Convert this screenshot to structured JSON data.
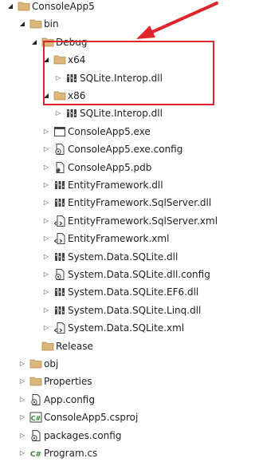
{
  "tree": [
    {
      "label": "ConsoleApp5",
      "icon": "folder-icon",
      "state": "expanded",
      "depth": 0,
      "name": "tree-item-consoleapp5"
    },
    {
      "label": "bin",
      "icon": "folder-icon",
      "state": "expanded",
      "depth": 1,
      "name": "tree-item-bin"
    },
    {
      "label": "Debug",
      "icon": "folder-icon",
      "state": "expanded",
      "depth": 2,
      "name": "tree-item-debug"
    },
    {
      "label": "x64",
      "icon": "folder-icon",
      "state": "expanded",
      "depth": 3,
      "name": "tree-item-x64"
    },
    {
      "label": "SQLite.Interop.dll",
      "icon": "dll-icon",
      "state": "collapsed",
      "depth": 4,
      "name": "tree-item-x64-sqlite-interop-dll"
    },
    {
      "label": "x86",
      "icon": "folder-icon",
      "state": "expanded",
      "depth": 3,
      "name": "tree-item-x86"
    },
    {
      "label": "SQLite.Interop.dll",
      "icon": "dll-icon",
      "state": "collapsed",
      "depth": 4,
      "name": "tree-item-x86-sqlite-interop-dll"
    },
    {
      "label": "ConsoleApp5.exe",
      "icon": "exe-icon",
      "state": "collapsed",
      "depth": 3,
      "name": "tree-item-consoleapp5-exe"
    },
    {
      "label": "ConsoleApp5.exe.config",
      "icon": "config-file-icon",
      "state": "collapsed",
      "depth": 3,
      "name": "tree-item-consoleapp5-exe-config"
    },
    {
      "label": "ConsoleApp5.pdb",
      "icon": "pdb-icon",
      "state": "collapsed",
      "depth": 3,
      "name": "tree-item-consoleapp5-pdb"
    },
    {
      "label": "EntityFramework.dll",
      "icon": "dll-icon",
      "state": "collapsed",
      "depth": 3,
      "name": "tree-item-entityframework-dll"
    },
    {
      "label": "EntityFramework.SqlServer.dll",
      "icon": "dll-icon",
      "state": "collapsed",
      "depth": 3,
      "name": "tree-item-entityframework-sqlserver-dll"
    },
    {
      "label": "EntityFramework.SqlServer.xml",
      "icon": "xml-file-icon",
      "state": "collapsed",
      "depth": 3,
      "name": "tree-item-entityframework-sqlserver-xml"
    },
    {
      "label": "EntityFramework.xml",
      "icon": "xml-file-icon",
      "state": "collapsed",
      "depth": 3,
      "name": "tree-item-entityframework-xml"
    },
    {
      "label": "System.Data.SQLite.dll",
      "icon": "dll-icon",
      "state": "collapsed",
      "depth": 3,
      "name": "tree-item-system-data-sqlite-dll"
    },
    {
      "label": "System.Data.SQLite.dll.config",
      "icon": "config-file-icon",
      "state": "collapsed",
      "depth": 3,
      "name": "tree-item-system-data-sqlite-dll-config"
    },
    {
      "label": "System.Data.SQLite.EF6.dll",
      "icon": "dll-icon",
      "state": "collapsed",
      "depth": 3,
      "name": "tree-item-system-data-sqlite-ef6-dll"
    },
    {
      "label": "System.Data.SQLite.Linq.dll",
      "icon": "dll-icon",
      "state": "collapsed",
      "depth": 3,
      "name": "tree-item-system-data-sqlite-linq-dll"
    },
    {
      "label": "System.Data.SQLite.xml",
      "icon": "xml-file-icon",
      "state": "collapsed",
      "depth": 3,
      "name": "tree-item-system-data-sqlite-xml"
    },
    {
      "label": "Release",
      "icon": "folder-icon",
      "state": "none",
      "depth": 2,
      "name": "tree-item-release"
    },
    {
      "label": "obj",
      "icon": "folder-icon",
      "state": "collapsed",
      "depth": 1,
      "name": "tree-item-obj"
    },
    {
      "label": "Properties",
      "icon": "folder-icon",
      "state": "collapsed",
      "depth": 1,
      "name": "tree-item-properties"
    },
    {
      "label": "App.config",
      "icon": "config-file-icon",
      "state": "collapsed",
      "depth": 1,
      "name": "tree-item-app-config"
    },
    {
      "label": "ConsoleApp5.csproj",
      "icon": "csharp-project-icon",
      "state": "collapsed",
      "depth": 1,
      "name": "tree-item-consoleapp5-csproj"
    },
    {
      "label": "packages.config",
      "icon": "config-file-icon",
      "state": "collapsed",
      "depth": 1,
      "name": "tree-item-packages-config"
    },
    {
      "label": "Program.cs",
      "icon": "csharp-file-icon",
      "state": "collapsed",
      "depth": 1,
      "name": "tree-item-program-cs"
    }
  ],
  "colors": {
    "folder": "#dcb67a",
    "annotation": "#e0242b",
    "csharp": "#368832"
  }
}
